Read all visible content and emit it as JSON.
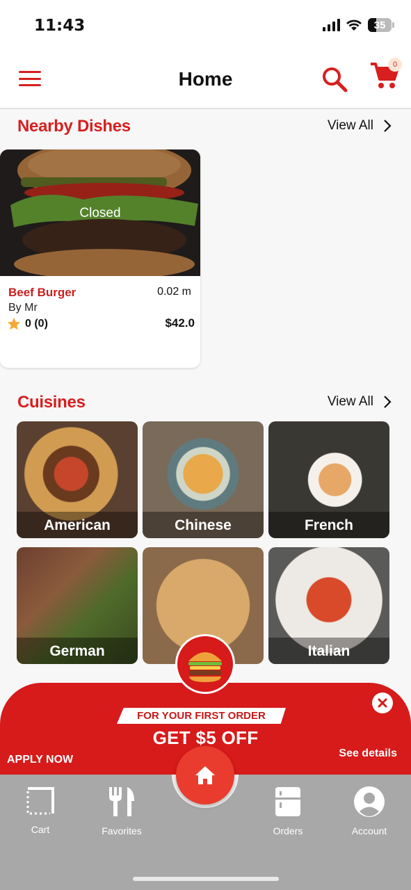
{
  "status_bar": {
    "time": "11:43",
    "battery": "35"
  },
  "header": {
    "title": "Home",
    "cart_count": "0"
  },
  "nearby": {
    "title": "Nearby Dishes",
    "view_all": "View All",
    "items": [
      {
        "status": "Closed",
        "name": "Beef Burger",
        "distance": "0.02 m",
        "by": "By Mr",
        "rating": "0 (0)",
        "price": "$42.0"
      }
    ]
  },
  "cuisines": {
    "title": "Cuisines",
    "view_all": "View All",
    "items": [
      {
        "label": "American"
      },
      {
        "label": "Chinese"
      },
      {
        "label": "French"
      },
      {
        "label": "German"
      },
      {
        "label": "Italian"
      }
    ]
  },
  "promo": {
    "ribbon": "FOR YOUR FIRST ORDER",
    "headline": "GET $5 OFF",
    "apply": "APPLY NOW",
    "details": "See details"
  },
  "bottom_nav": {
    "items": [
      {
        "label": "Cart",
        "icon": "cart-icon"
      },
      {
        "label": "Favorites",
        "icon": "fork-knife-icon"
      },
      {
        "label": "Orders",
        "icon": "orders-icon"
      },
      {
        "label": "Account",
        "icon": "account-icon"
      }
    ],
    "home_icon": "home-icon"
  },
  "colors": {
    "accent": "#d71f1f",
    "promo": "#d71a1a",
    "nav_bg": "#a8a8a8",
    "home": "#e93c2f"
  }
}
